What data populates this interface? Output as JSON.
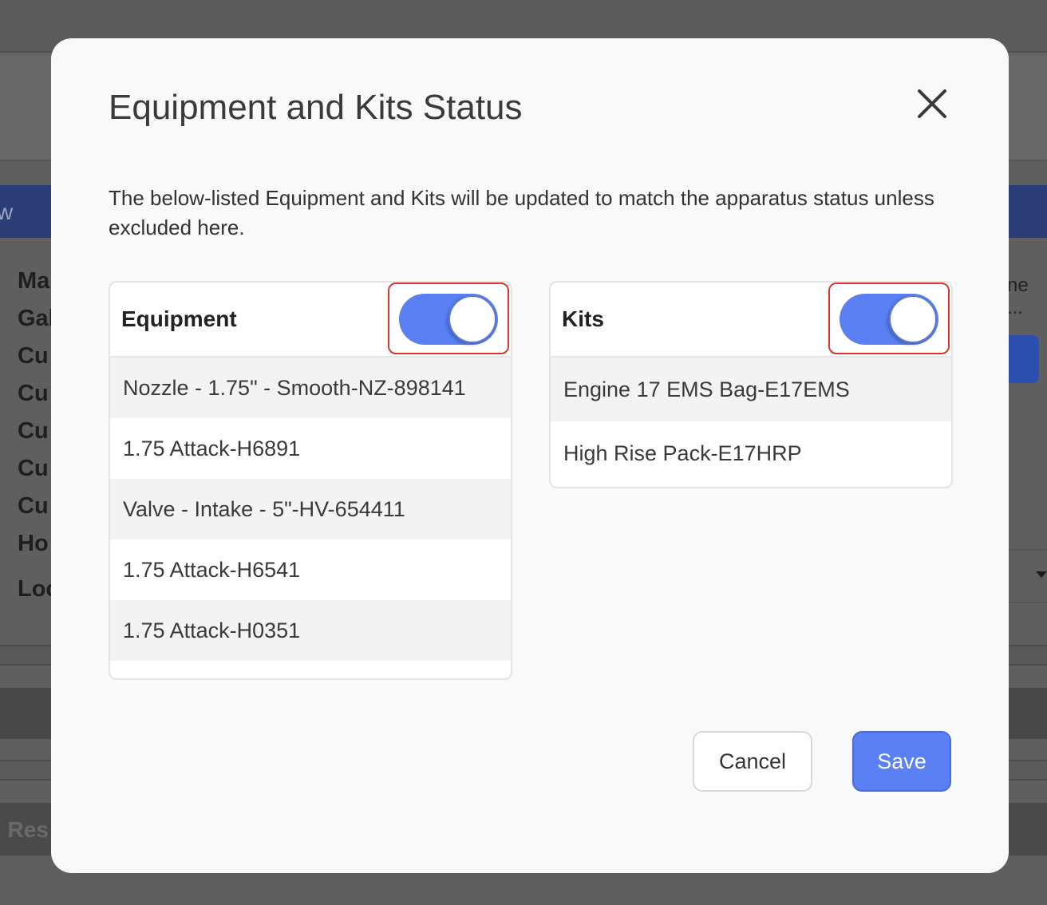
{
  "background": {
    "header_partial": "w",
    "field_labels": [
      "Ma",
      "Gal",
      "Cu",
      "Cu",
      "Cu",
      "Cu",
      "Cu",
      "Ho",
      "Loc"
    ],
    "right_text": "ne ...",
    "bottom_partial": "l Res"
  },
  "modal": {
    "title": "Equipment and Kits Status",
    "description": "The below-listed Equipment and Kits will be updated to match the apparatus status unless excluded here.",
    "close_icon": "close-icon",
    "equipment": {
      "title": "Equipment",
      "toggle_on": true,
      "items": [
        "Nozzle - 1.75\" - Smooth-NZ-898141",
        "1.75 Attack-H6891",
        "Valve - Intake - 5\"-HV-654411",
        "1.75 Attack-H6541",
        "1.75 Attack-H0351"
      ]
    },
    "kits": {
      "title": "Kits",
      "toggle_on": true,
      "items": [
        "Engine 17 EMS Bag-E17EMS",
        "High Rise Pack-E17HRP"
      ]
    },
    "buttons": {
      "cancel": "Cancel",
      "save": "Save"
    }
  },
  "colors": {
    "accent": "#5a80f4",
    "highlight_border": "#d9372b",
    "overlay": "#5f5f5f"
  }
}
